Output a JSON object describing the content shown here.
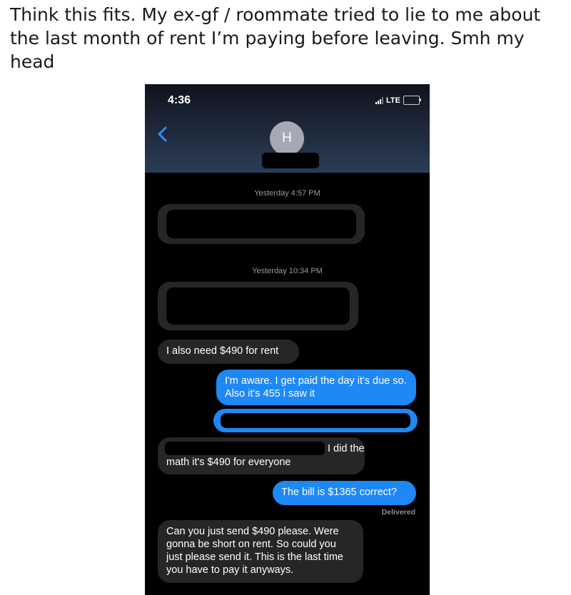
{
  "post": {
    "caption": "Think this fits. My ex-gf / roommate tried to lie to me about the last month of rent I’m paying before leaving. Smh my head"
  },
  "status_bar": {
    "time": "4:36",
    "network": "LTE"
  },
  "contact": {
    "initial": "H"
  },
  "timestamps": [
    "Yesterday 4:57 PM",
    "Yesterday 10:34 PM"
  ],
  "messages": {
    "m1": {
      "from": "them",
      "text": "I also need $490 for rent"
    },
    "m2": {
      "from": "me",
      "text": "I'm aware. I get paid the day it's due so. Also it's 455 i saw it"
    },
    "m3": {
      "from": "them",
      "line1": "I did the",
      "line2": "math it's $490 for everyone"
    },
    "m4": {
      "from": "me",
      "text": "The bill is $1365 correct?"
    },
    "m5": {
      "from": "them",
      "text": "Can you just send $490 please. Were gonna be short on rent. So could you just please send it. This is the last time you have to pay it anyways."
    }
  },
  "delivered_label": "Delivered",
  "colors": {
    "sent_bubble": "#1e88f6",
    "received_bubble": "#262629",
    "screen_background": "#000000",
    "battery": "#ffd60a"
  }
}
